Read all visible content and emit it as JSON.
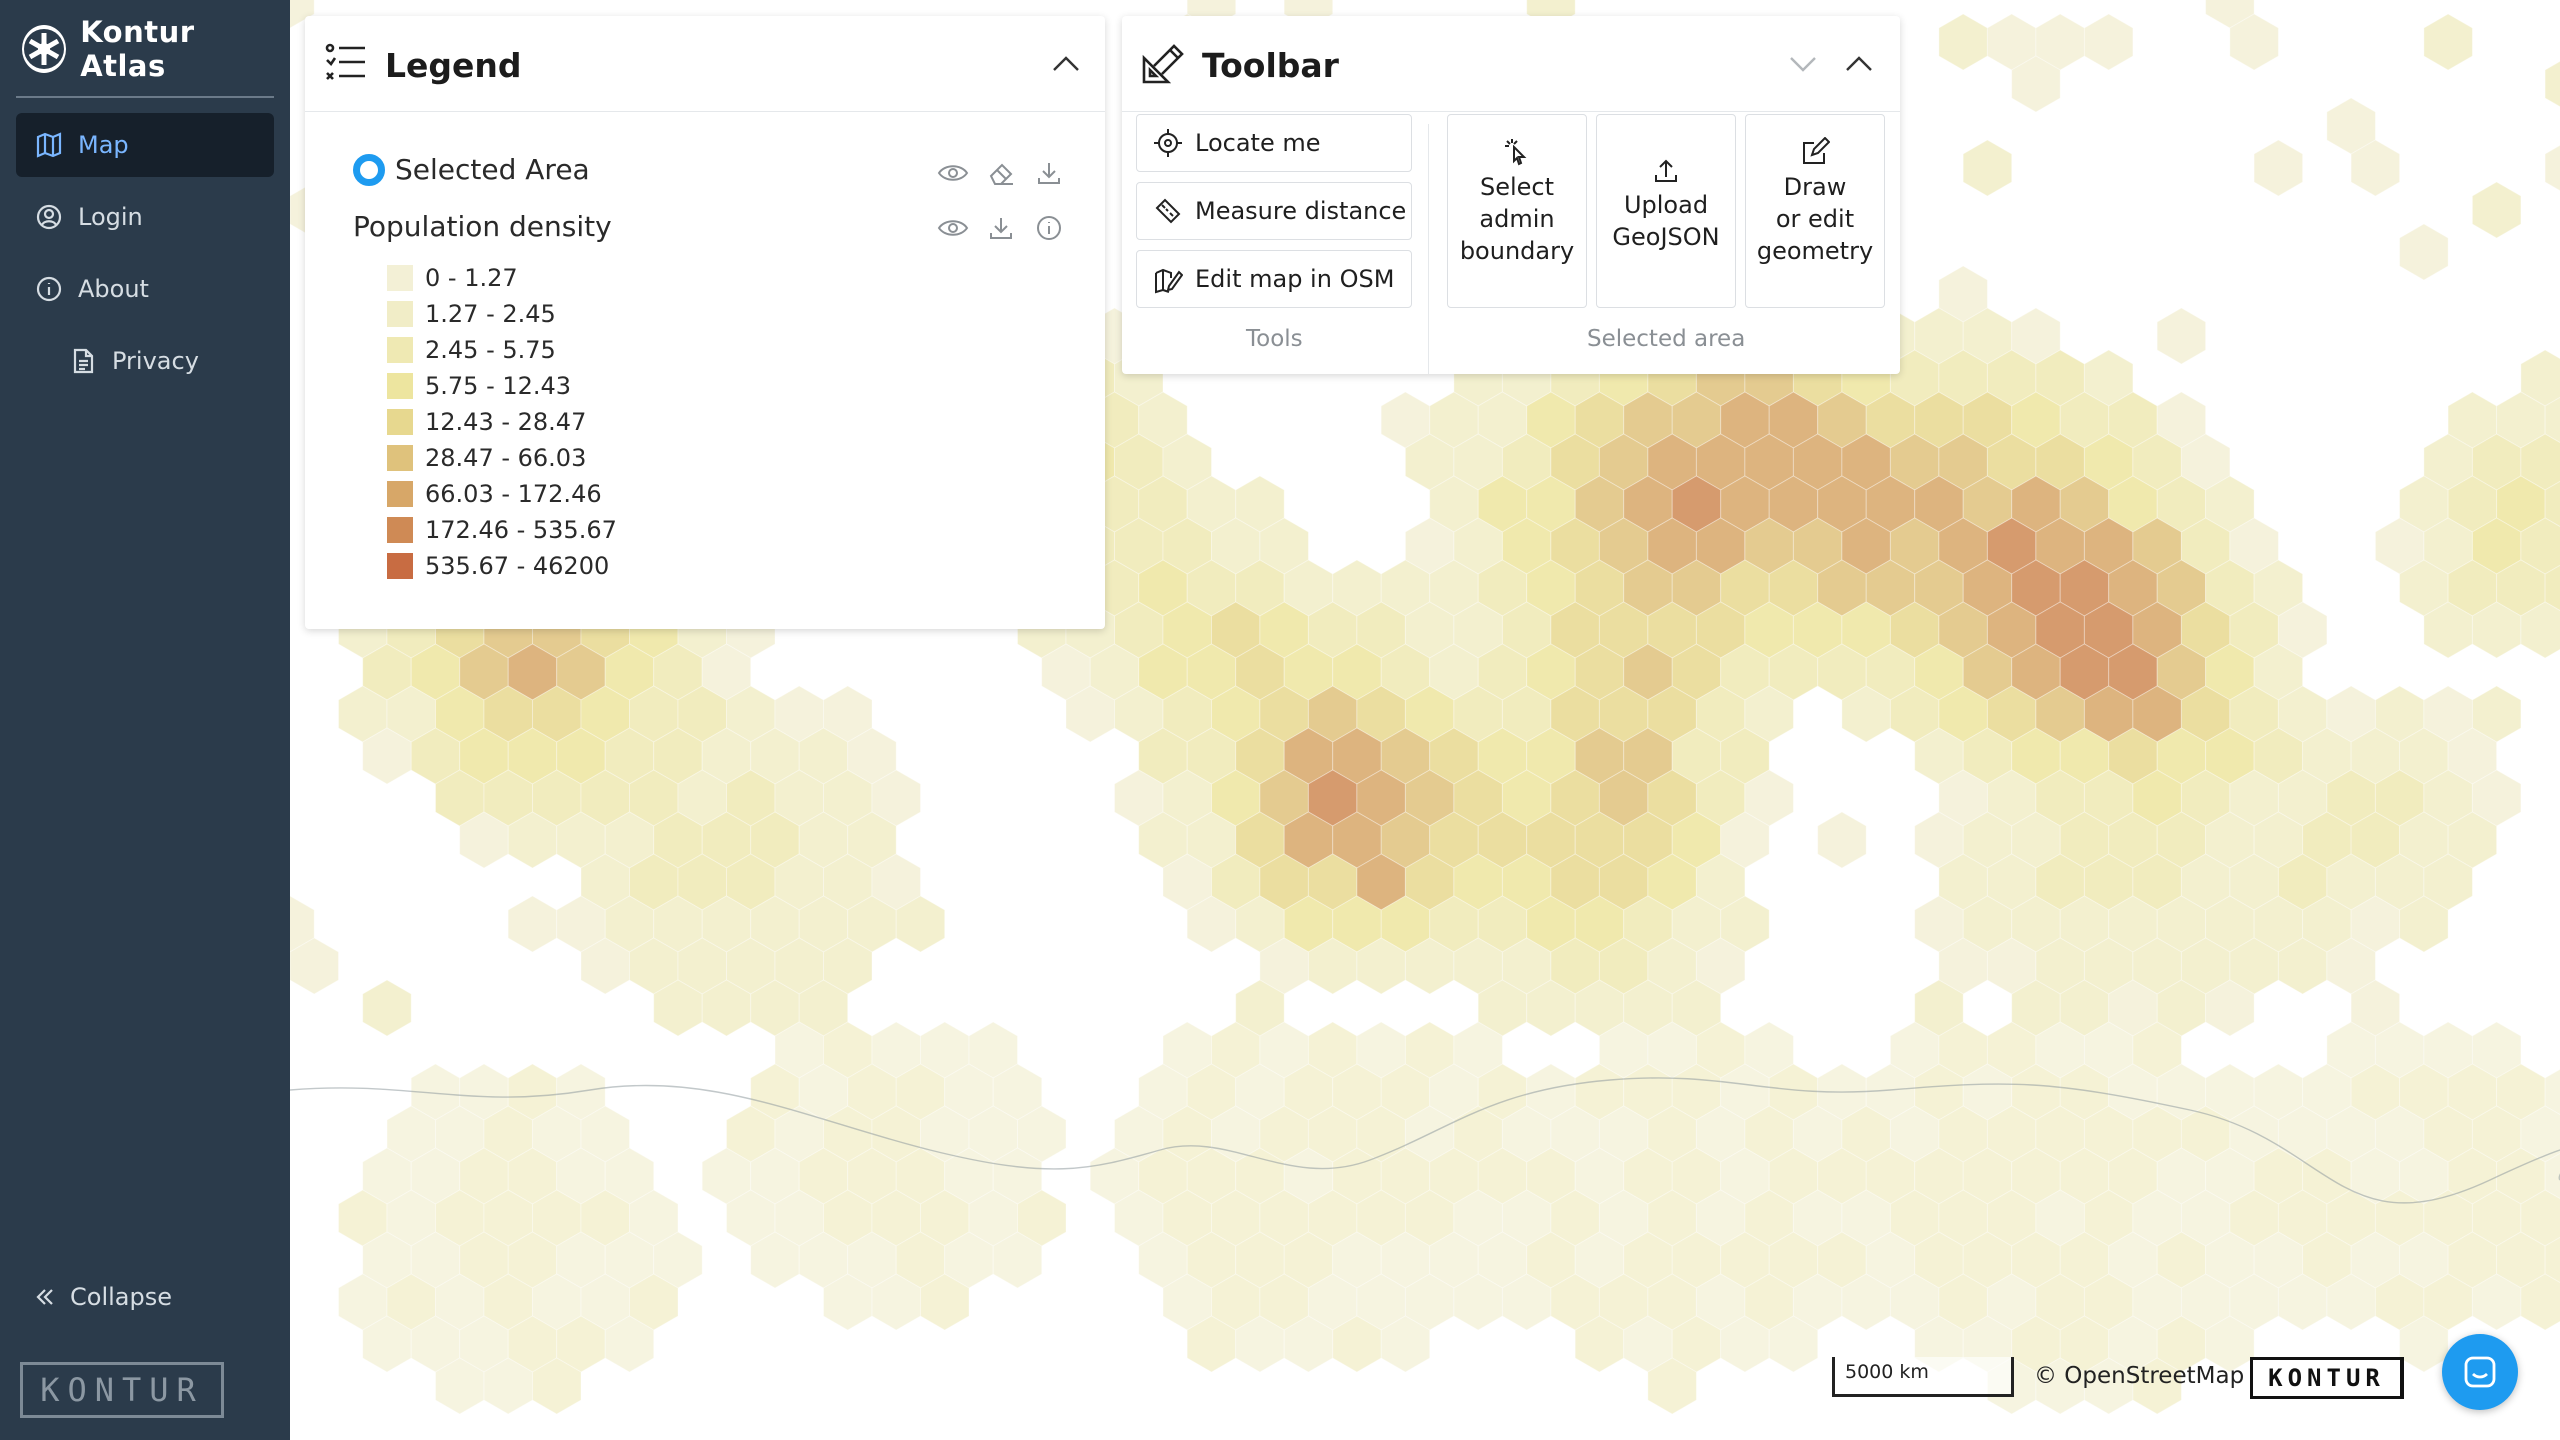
{
  "app": {
    "name": "Kontur Atlas",
    "wordmark": "KONTUR"
  },
  "sidebar": {
    "items": [
      {
        "label": "Map",
        "icon": "map-icon",
        "active": true
      },
      {
        "label": "Login",
        "icon": "user-circle-icon",
        "active": false
      },
      {
        "label": "About",
        "icon": "info-icon",
        "active": false
      },
      {
        "label": "Privacy",
        "icon": "document-icon",
        "active": false
      }
    ],
    "collapse_label": "Collapse"
  },
  "legend": {
    "title": "Legend",
    "selected_area_label": "Selected Area",
    "layer_title": "Population density",
    "items": [
      {
        "label": "0 - 1.27",
        "color": "#f3f0d6"
      },
      {
        "label": "1.27 - 2.45",
        "color": "#f1edc7"
      },
      {
        "label": "2.45 - 5.75",
        "color": "#efe9b3"
      },
      {
        "label": "5.75 - 12.43",
        "color": "#ede59f"
      },
      {
        "label": "12.43 - 28.47",
        "color": "#e7d88f"
      },
      {
        "label": "28.47 - 66.03",
        "color": "#dfc27c"
      },
      {
        "label": "66.03 - 172.46",
        "color": "#d7a768"
      },
      {
        "label": "172.46 - 535.67",
        "color": "#cf8a55"
      },
      {
        "label": "535.67 - 46200",
        "color": "#c86c42"
      }
    ]
  },
  "toolbar": {
    "title": "Toolbar",
    "tools": [
      {
        "label": "Locate me",
        "icon": "crosshair-icon"
      },
      {
        "label": "Measure distance",
        "icon": "ruler-icon"
      },
      {
        "label": "Edit map in OSM",
        "icon": "map-edit-icon"
      }
    ],
    "tools_group_label": "Tools",
    "area_buttons": [
      {
        "lines": [
          "Select",
          "admin",
          "boundary"
        ],
        "icon": "pointer-click-icon"
      },
      {
        "lines": [
          "Upload",
          "GeoJSON"
        ],
        "icon": "upload-icon"
      },
      {
        "lines": [
          "Draw",
          "or edit",
          "geometry"
        ],
        "icon": "edit-geometry-icon"
      }
    ],
    "area_group_label": "Selected area"
  },
  "map": {
    "scale_label": "5000 km",
    "attribution": "© OpenStreetMap",
    "logo": "KONTUR"
  },
  "colors": {
    "sidebar_bg": "#2b3b4b",
    "accent": "#1e9bf0",
    "active_nav_text": "#7ab6ff"
  }
}
